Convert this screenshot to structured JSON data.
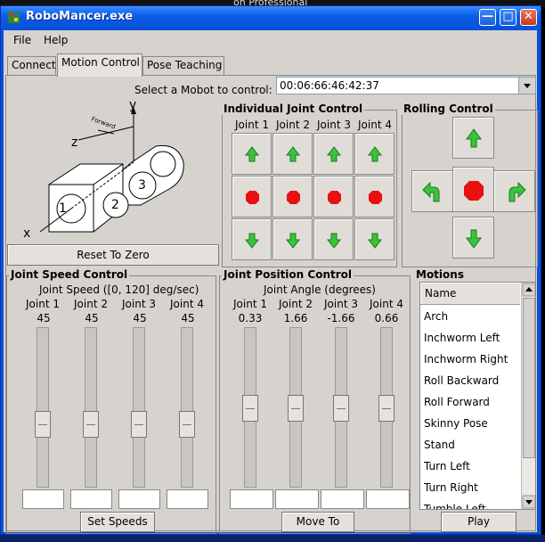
{
  "window": {
    "title": "RoboMancer.exe"
  },
  "background": {
    "top_fragment": "on Professional"
  },
  "menu": [
    "File",
    "Help"
  ],
  "tabs": [
    "Connect",
    "Motion Control",
    "Pose Teaching"
  ],
  "mobot_select": {
    "label": "Select a Mobot to control:",
    "value": "00:06:66:46:42:37"
  },
  "diagram": {
    "axes": [
      "x",
      "y",
      "z"
    ],
    "forward_label": "Forward",
    "joint_numbers": [
      "1",
      "2",
      "3"
    ],
    "reset_label": "Reset To Zero"
  },
  "individual_joint": {
    "title": "Individual Joint Control",
    "joints": [
      "Joint 1",
      "Joint 2",
      "Joint 3",
      "Joint 4"
    ]
  },
  "rolling": {
    "title": "Rolling Control"
  },
  "speed": {
    "title": "Joint Speed Control",
    "subtitle": "Joint Speed ([0, 120] deg/sec)",
    "joints": [
      "Joint 1",
      "Joint 2",
      "Joint 3",
      "Joint 4"
    ],
    "values": [
      "45",
      "45",
      "45",
      "45"
    ],
    "level": [
      0.375,
      0.375,
      0.375,
      0.375
    ],
    "button": "Set Speeds"
  },
  "position": {
    "title": "Joint Position Control",
    "subtitle": "Joint Angle (degrees)",
    "joints": [
      "Joint 1",
      "Joint 2",
      "Joint 3",
      "Joint 4"
    ],
    "values": [
      "0.33",
      "1.66",
      "-1.66",
      "0.66"
    ],
    "button": "Move To"
  },
  "motions": {
    "title": "Motions",
    "header": "Name",
    "items": [
      "Arch",
      "Inchworm Left",
      "Inchworm Right",
      "Roll Backward",
      "Roll Forward",
      "Skinny Pose",
      "Stand",
      "Turn Left",
      "Turn Right",
      "Tumble Left"
    ],
    "button": "Play"
  },
  "colors": {
    "titlebar": "#0a5ce8",
    "face": "#d6d3ce",
    "arrow_green": "#3cc23c",
    "stop_red": "#e81010"
  }
}
